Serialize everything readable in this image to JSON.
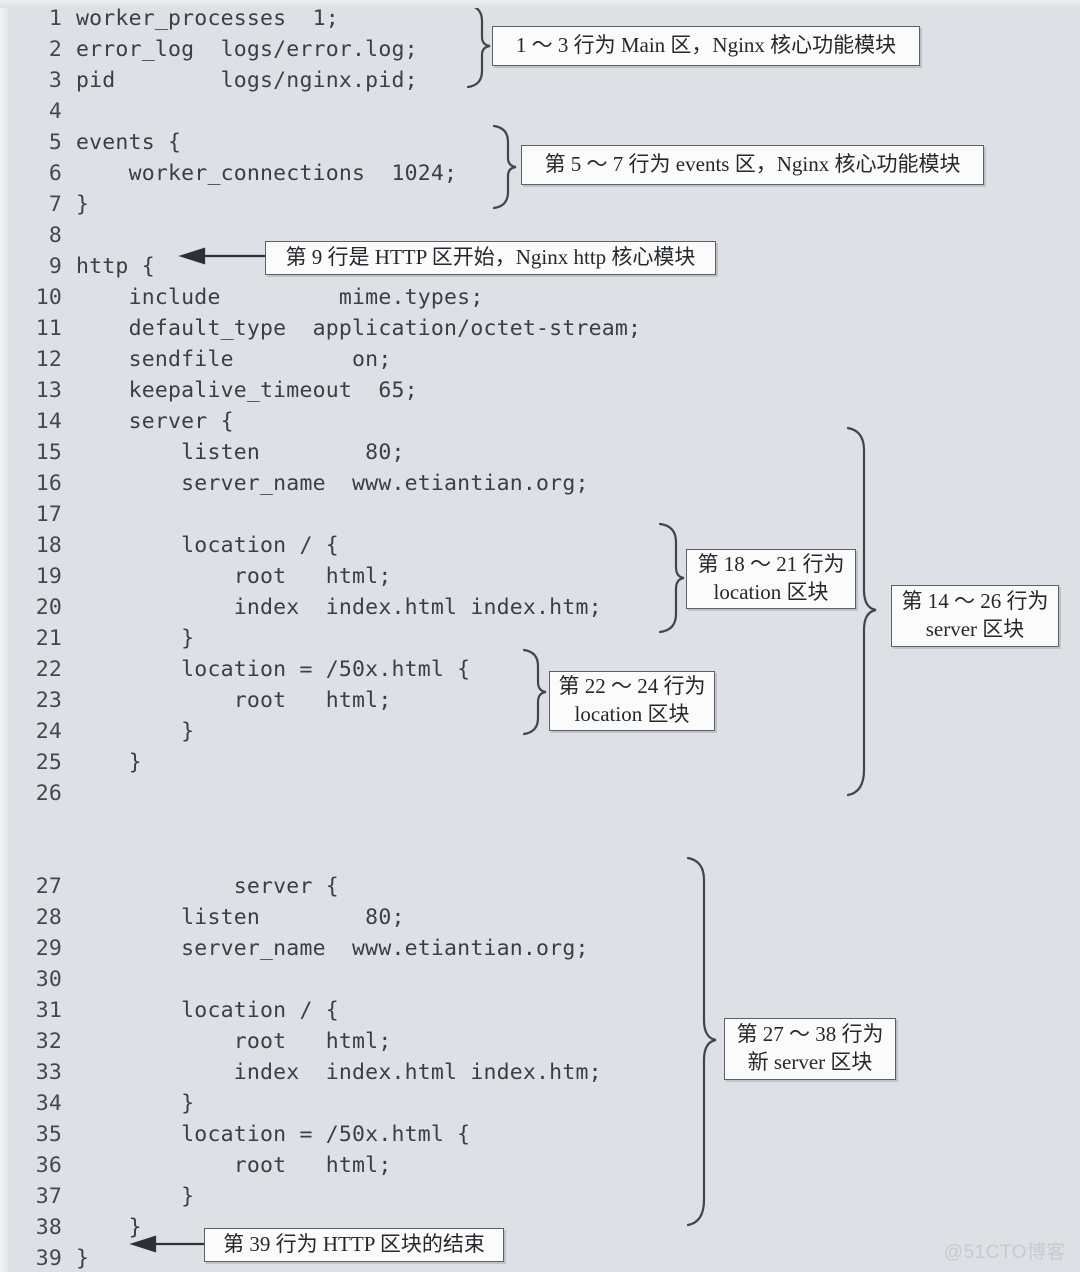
{
  "figure": {
    "kind": "annotated-code-figure",
    "background_color": "#dde1e5",
    "code_color": "#3a3f44",
    "callout_bg": "#fbfbfb",
    "callout_border": "#5d6166"
  },
  "code_lines": [
    {
      "num": "1",
      "text": "worker_processes  1;"
    },
    {
      "num": "2",
      "text": "error_log  logs/error.log;"
    },
    {
      "num": "3",
      "text": "pid        logs/nginx.pid;"
    },
    {
      "num": "4",
      "text": ""
    },
    {
      "num": "5",
      "text": "events {"
    },
    {
      "num": "6",
      "text": "    worker_connections  1024;"
    },
    {
      "num": "7",
      "text": "}"
    },
    {
      "num": "8",
      "text": ""
    },
    {
      "num": "9",
      "text": "http {"
    },
    {
      "num": "10",
      "text": "    include         mime.types;"
    },
    {
      "num": "11",
      "text": "    default_type  application/octet-stream;"
    },
    {
      "num": "12",
      "text": "    sendfile         on;"
    },
    {
      "num": "13",
      "text": "    keepalive_timeout  65;"
    },
    {
      "num": "14",
      "text": "    server {"
    },
    {
      "num": "15",
      "text": "        listen        80;"
    },
    {
      "num": "16",
      "text": "        server_name  www.etiantian.org;"
    },
    {
      "num": "17",
      "text": ""
    },
    {
      "num": "18",
      "text": "        location / {"
    },
    {
      "num": "19",
      "text": "            root   html;"
    },
    {
      "num": "20",
      "text": "            index  index.html index.htm;"
    },
    {
      "num": "21",
      "text": "        }"
    },
    {
      "num": "22",
      "text": "        location = /50x.html {"
    },
    {
      "num": "23",
      "text": "            root   html;"
    },
    {
      "num": "24",
      "text": "        }"
    },
    {
      "num": "25",
      "text": "    }"
    },
    {
      "num": "26",
      "text": ""
    },
    {
      "num": "27",
      "text": "            server {"
    },
    {
      "num": "28",
      "text": "        listen        80;"
    },
    {
      "num": "29",
      "text": "        server_name  www.etiantian.org;"
    },
    {
      "num": "30",
      "text": ""
    },
    {
      "num": "31",
      "text": "        location / {"
    },
    {
      "num": "32",
      "text": "            root   html;"
    },
    {
      "num": "33",
      "text": "            index  index.html index.htm;"
    },
    {
      "num": "34",
      "text": "        }"
    },
    {
      "num": "35",
      "text": "        location = /50x.html {"
    },
    {
      "num": "36",
      "text": "            root   html;"
    },
    {
      "num": "37",
      "text": "        }"
    },
    {
      "num": "38",
      "text": "    }"
    },
    {
      "num": "39",
      "text": "}"
    }
  ],
  "callouts": [
    {
      "id": "main-zone",
      "line1": "1 ～ 3 行为 Main 区，Nginx 核心功能模块",
      "line2": ""
    },
    {
      "id": "events-zone",
      "line1": "第 5 ～ 7 行为 events 区，Nginx 核心功能模块",
      "line2": ""
    },
    {
      "id": "http-start",
      "line1": "第 9 行是 HTTP 区开始，Nginx http 核心模块",
      "line2": ""
    },
    {
      "id": "location-18-21",
      "line1": "第 18 ～ 21 行为",
      "line2": "location 区块"
    },
    {
      "id": "location-22-24",
      "line1": "第 22 ～ 24 行为",
      "line2": "location 区块"
    },
    {
      "id": "server-14-26",
      "line1": "第 14 ～ 26 行为",
      "line2": "server 区块"
    },
    {
      "id": "new-server-27-38",
      "line1": "第 27 ～ 38 行为",
      "line2": "新 server 区块"
    },
    {
      "id": "http-end",
      "line1": "第 39 行为 HTTP 区块的结束",
      "line2": ""
    }
  ],
  "watermark": {
    "text": "@51CTO博客"
  }
}
